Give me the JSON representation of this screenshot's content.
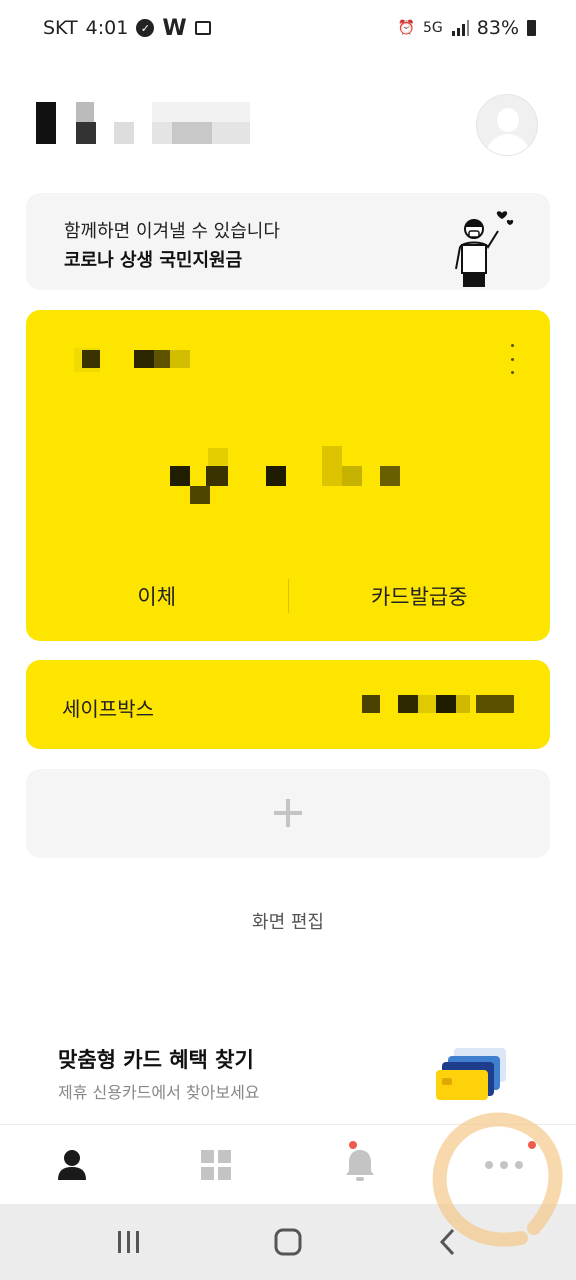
{
  "status_bar": {
    "carrier": "SKT",
    "time": "4:01",
    "network": "5G",
    "battery": "83%"
  },
  "banner": {
    "line1": "함께하면 이겨낼 수 있습니다",
    "line2": "코로나 상생 국민지원금"
  },
  "account_card": {
    "transfer_label": "이체",
    "card_status_label": "카드발급중",
    "background_color": "#fee500"
  },
  "safebox": {
    "label": "세이프박스"
  },
  "edit_screen_label": "화면 편집",
  "promo": {
    "title": "맞춤형 카드 혜택 찾기",
    "subtitle": "제휴 신용카드에서 찾아보세요"
  },
  "bottom_nav": {
    "items": [
      {
        "icon": "person-icon",
        "active": true,
        "badge": false
      },
      {
        "icon": "grid-icon",
        "active": false,
        "badge": false
      },
      {
        "icon": "bell-icon",
        "active": false,
        "badge": true
      },
      {
        "icon": "more-icon",
        "active": false,
        "badge": true
      }
    ],
    "badge_color": "#f15b4b"
  }
}
